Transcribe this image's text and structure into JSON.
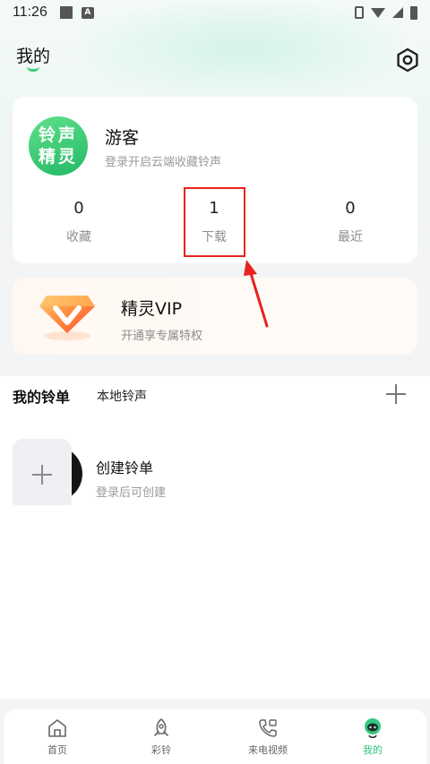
{
  "status_bar": {
    "time": "11:26",
    "notification_icon": "A"
  },
  "header": {
    "title": "我的"
  },
  "user": {
    "avatar_line1": "铃声",
    "avatar_line2": "精灵",
    "name": "游客",
    "subtitle": "登录开启云端收藏铃声"
  },
  "stats": [
    {
      "value": "0",
      "label": "收藏"
    },
    {
      "value": "1",
      "label": "下载"
    },
    {
      "value": "0",
      "label": "最近"
    }
  ],
  "vip": {
    "title": "精灵VIP",
    "subtitle": "开通享专属特权"
  },
  "lists": {
    "tab_mine": "我的铃单",
    "tab_local": "本地铃声",
    "create_title": "创建铃单",
    "create_subtitle": "登录后可创建"
  },
  "nav": [
    {
      "label": "首页",
      "icon": "home-icon"
    },
    {
      "label": "彩铃",
      "icon": "rocket-icon"
    },
    {
      "label": "来电视频",
      "icon": "phone-video-icon"
    },
    {
      "label": "我的",
      "icon": "mine-icon"
    }
  ],
  "colors": {
    "accent": "#2fc17a",
    "highlight": "#e8231f"
  }
}
